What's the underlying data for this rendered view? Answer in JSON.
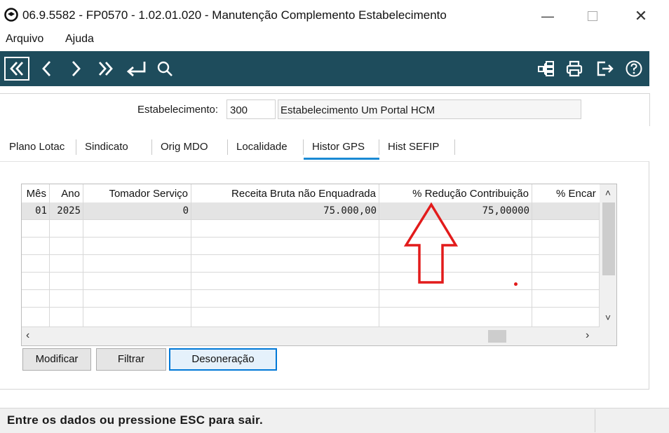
{
  "window": {
    "title": "06.9.5582 - FP0570 - 1.02.01.020 - Manutenção Complemento Estabelecimento",
    "minimize_glyph": "—",
    "close_glyph": "✕"
  },
  "menu": {
    "items": [
      "Arquivo",
      "Ajuda"
    ]
  },
  "toolbar": {
    "left_icons": [
      "first-record-icon",
      "previous-icon",
      "next-icon",
      "last-record-icon",
      "enter-icon",
      "search-icon"
    ],
    "right_icons": [
      "structure-icon",
      "print-icon",
      "exit-icon",
      "help-icon"
    ],
    "background": "#1e4c5c"
  },
  "form": {
    "estabelecimento_label": "Estabelecimento:",
    "estabelecimento_code": "300",
    "estabelecimento_name": "Estabelecimento Um Portal HCM"
  },
  "tabs": [
    {
      "label": "Plano Lotac",
      "active": false
    },
    {
      "label": "Sindicato",
      "active": false
    },
    {
      "label": "Orig MDO",
      "active": false
    },
    {
      "label": "Localidade",
      "active": false
    },
    {
      "label": "Histor GPS",
      "active": true
    },
    {
      "label": "Hist SEFIP",
      "active": false
    }
  ],
  "grid": {
    "columns": [
      "Mês",
      "Ano",
      "Tomador Serviço",
      "Receita Bruta não Enquadrada",
      "% Redução Contribuição",
      "% Encar"
    ],
    "rows": [
      [
        "01",
        "2025",
        "0",
        "75.000,00",
        "75,00000",
        ""
      ]
    ],
    "empty_rows": 6
  },
  "buttons": {
    "modificar": "Modificar",
    "filtrar": "Filtrar",
    "desoneracao": "Desoneração"
  },
  "status": {
    "message": "Entre os dados ou pressione ESC para sair."
  },
  "colors": {
    "accent": "#0078d7",
    "tab_underline": "#1a8ad4",
    "annotation": "#e21b1b"
  }
}
